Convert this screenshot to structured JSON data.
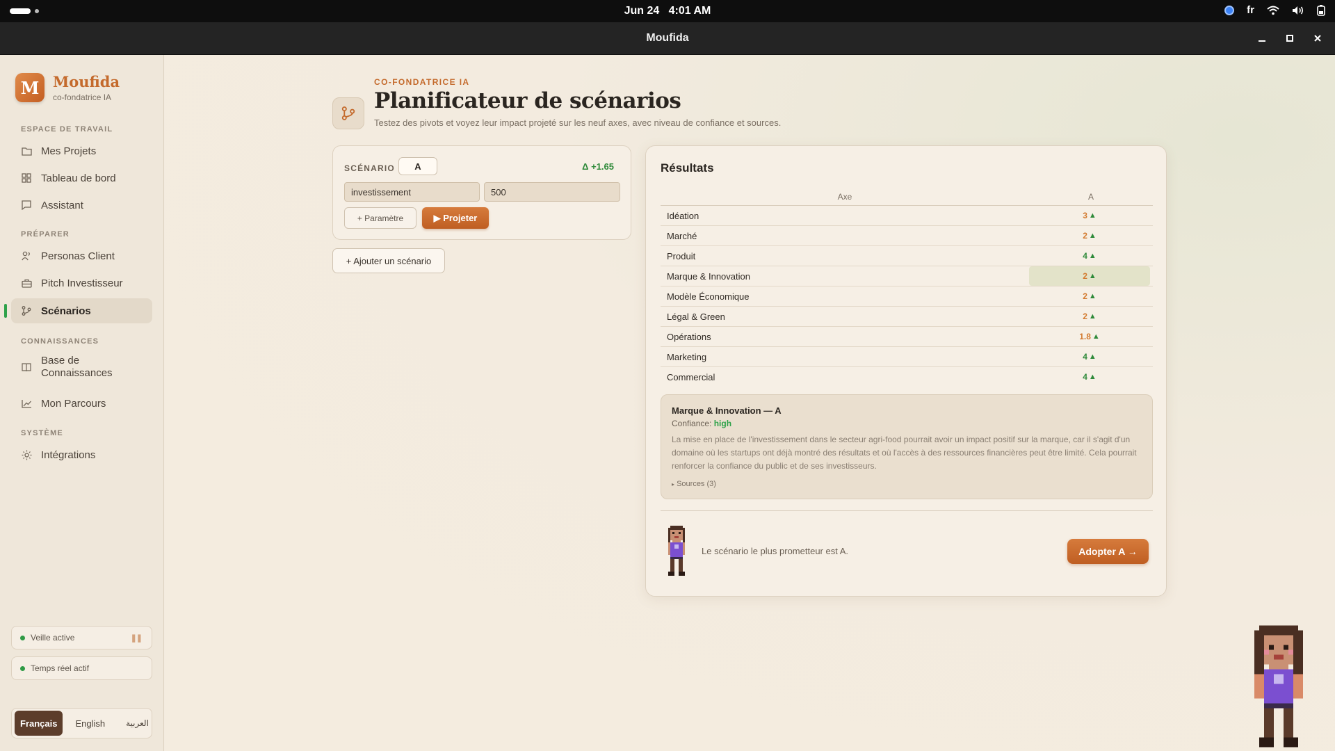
{
  "os": {
    "date": "Jun 24",
    "time": "4:01 AM",
    "lang": "fr"
  },
  "window": {
    "title": "Moufida"
  },
  "brand": {
    "initial": "M",
    "name": "Moufida",
    "subtitle": "co-fondatrice IA"
  },
  "sidebar": {
    "sections": [
      {
        "title": "ESPACE DE TRAVAIL",
        "items": [
          {
            "label": "Mes Projets",
            "icon": "folder-icon"
          },
          {
            "label": "Tableau de bord",
            "icon": "grid-icon"
          },
          {
            "label": "Assistant",
            "icon": "message-icon"
          }
        ]
      },
      {
        "title": "PRÉPARER",
        "items": [
          {
            "label": "Personas Client",
            "icon": "users-icon"
          },
          {
            "label": "Pitch Investisseur",
            "icon": "briefcase-icon"
          },
          {
            "label": "Scénarios",
            "icon": "branch-icon",
            "active": true
          }
        ]
      },
      {
        "title": "CONNAISSANCES",
        "items": [
          {
            "label": "Base de Connaissances",
            "icon": "book-icon"
          },
          {
            "label": "Mon Parcours",
            "icon": "chart-line-icon"
          }
        ]
      },
      {
        "title": "SYSTÈME",
        "items": [
          {
            "label": "Intégrations",
            "icon": "sun-icon"
          }
        ]
      }
    ],
    "status": [
      {
        "label": "Veille active"
      },
      {
        "label": "Temps réel actif"
      }
    ],
    "languages": [
      {
        "label": "Français",
        "active": true
      },
      {
        "label": "English"
      },
      {
        "label": "العربية"
      }
    ]
  },
  "header": {
    "kicker": "CO-FONDATRICE IA",
    "title": "Planificateur de scénarios",
    "subtitle": "Testez des pivots et voyez leur impact projeté sur les neuf axes, avec niveau de confiance et sources."
  },
  "scenario": {
    "label": "SCÉNARIO",
    "name": "A",
    "delta": "Δ +1.65",
    "param_key": "investissement",
    "param_value": "500",
    "add_param": "+ Paramètre",
    "project": "▶ Projeter"
  },
  "add_scenario": "+ Ajouter un scénario",
  "results": {
    "title": "Résultats",
    "col_axis": "Axe",
    "col_a": "A",
    "rows": [
      {
        "axis": "Idéation",
        "value": "3",
        "color": "#d37a2f"
      },
      {
        "axis": "Marché",
        "value": "2",
        "color": "#d37a2f"
      },
      {
        "axis": "Produit",
        "value": "4",
        "color": "#2f8a3a"
      },
      {
        "axis": "Marque & Innovation",
        "value": "2",
        "color": "#d37a2f",
        "selected": true
      },
      {
        "axis": "Modèle Économique",
        "value": "2",
        "color": "#d37a2f"
      },
      {
        "axis": "Légal & Green",
        "value": "2",
        "color": "#d37a2f"
      },
      {
        "axis": "Opérations",
        "value": "1.8",
        "color": "#d37a2f"
      },
      {
        "axis": "Marketing",
        "value": "4",
        "color": "#2f8a3a"
      },
      {
        "axis": "Commercial",
        "value": "4",
        "color": "#2f8a3a"
      }
    ],
    "detail": {
      "title": "Marque & Innovation — A",
      "confidence_label": "Confiance:",
      "confidence": "high",
      "text": "La mise en place de l'investissement dans le secteur agri-food pourrait avoir un impact positif sur la marque, car il s'agit d'un domaine où les startups ont déjà montré des résultats et où l'accès à des ressources financières peut être limité. Cela pourrait renforcer la confiance du public et de ses investisseurs.",
      "sources": "Sources (3)"
    },
    "footer_text": "Le scénario le plus prometteur est A.",
    "adopt": "Adopter A →"
  }
}
